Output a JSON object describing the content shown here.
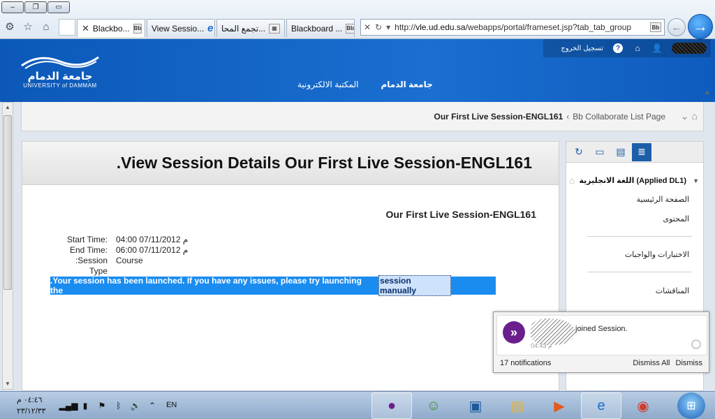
{
  "browser": {
    "window_buttons": [
      "–",
      "❐",
      "▭"
    ],
    "tabs": [
      {
        "title": "Blackbo...",
        "close": "✕",
        "favicon": "Bb",
        "active": true
      },
      {
        "title": "View Sessio...",
        "favicon": "e"
      },
      {
        "title": "تجمع المحا...",
        "favicon": "▦"
      },
      {
        "title": "Blackboard ...",
        "favicon": "Bb"
      }
    ],
    "url_prefix": "http://",
    "url_domain": "vle.ud.edu.sa",
    "url_path": "/webapps/portal/frameset.jsp?tab_tab_group",
    "url_favicon": "Bb",
    "addr_controls": [
      "✕",
      "↻",
      "▾"
    ]
  },
  "header": {
    "logo_ar": "جامعة الدمام",
    "logo_en": "UNIVERSITY of DAMMAM",
    "nav": [
      {
        "label": "جامعة الدمام"
      },
      {
        "label": "المكتبة الالكترونية"
      }
    ],
    "logout_label": "تسجيل الخروج",
    "help_label": "?"
  },
  "breadcrumb": {
    "parent": "Bb Collaborate List Page",
    "current": "Our First Live Session-ENGL161",
    "separator": "‹"
  },
  "content": {
    "page_title": ".View Session Details Our First Live Session-ENGL161",
    "session_name": "Our First Live Session-ENGL161",
    "details": [
      {
        "label": "Start Time:",
        "value": "04:00 07/11/2012 م"
      },
      {
        "label": "End Time:",
        "value": "06:00 07/11/2012 م"
      },
      {
        "label": ":Session Type",
        "value": "Course"
      }
    ],
    "banner_text": ".Your session has been launched. If you have any issues, please try launching the",
    "banner_link": "session manually"
  },
  "course_menu": {
    "course_title": "اللغة الانجليزية (Applied DL1)",
    "items": [
      {
        "label": "الصفحة الرئيسية"
      },
      {
        "label": "المحتوى"
      },
      {
        "label": "الاختبارات والواجبات"
      },
      {
        "label": "المناقشات"
      }
    ]
  },
  "notification": {
    "text": "joined Session.",
    "time": "م 04:43",
    "count_label": "17 notifications",
    "dismiss_all_label": "Dismiss All",
    "dismiss_label": "Dismiss"
  },
  "taskbar": {
    "time": "٠٤:٤٦ م",
    "date": "٢٣/١٢/٣٣",
    "language": "EN"
  }
}
